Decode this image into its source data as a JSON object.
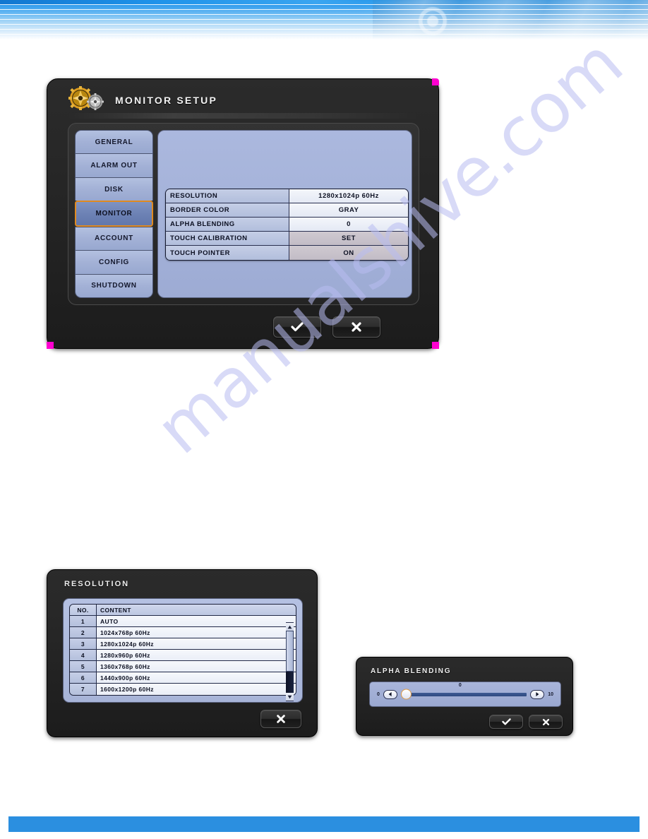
{
  "page": {
    "watermark": "manualshive.com",
    "accent_blue": "#2b8fe0",
    "panel_blue": "#a8b5d9",
    "highlight_orange": "#e08a20"
  },
  "monitor_setup": {
    "title": "MONITOR SETUP",
    "icon": "gears-icon",
    "sidebar": [
      {
        "label": "GENERAL",
        "selected": false
      },
      {
        "label": "ALARM OUT",
        "selected": false
      },
      {
        "label": "DISK",
        "selected": false
      },
      {
        "label": "MONITOR",
        "selected": true
      },
      {
        "label": "ACCOUNT",
        "selected": false
      },
      {
        "label": "CONFIG",
        "selected": false
      },
      {
        "label": "SHUTDOWN",
        "selected": false
      }
    ],
    "settings": [
      {
        "key": "RESOLUTION",
        "value": "1280x1024p 60Hz",
        "dim": false
      },
      {
        "key": "BORDER COLOR",
        "value": "GRAY",
        "dim": false
      },
      {
        "key": "ALPHA BLENDING",
        "value": "0",
        "dim": false
      },
      {
        "key": "TOUCH CALIBRATION",
        "value": "SET",
        "dim": true
      },
      {
        "key": "TOUCH POINTER",
        "value": "ON",
        "dim": true
      }
    ],
    "buttons": {
      "confirm": "check-icon",
      "cancel": "close-icon"
    }
  },
  "resolution_dialog": {
    "title": "RESOLUTION",
    "columns": [
      "NO.",
      "CONTENT"
    ],
    "rows": [
      {
        "no": "1",
        "content": "AUTO"
      },
      {
        "no": "2",
        "content": "1024x768p 60Hz"
      },
      {
        "no": "3",
        "content": "1280x1024p 60Hz"
      },
      {
        "no": "4",
        "content": "1280x960p 60Hz"
      },
      {
        "no": "5",
        "content": "1360x768p 60Hz"
      },
      {
        "no": "6",
        "content": "1440x900p 60Hz"
      },
      {
        "no": "7",
        "content": "1600x1200p 60Hz"
      }
    ],
    "scrollbar": {
      "up": "scroll-up-icon",
      "down": "scroll-down-icon"
    },
    "buttons": {
      "cancel": "close-icon"
    }
  },
  "alpha_dialog": {
    "title": "ALPHA BLENDING",
    "min": "0",
    "max": "10",
    "value": "0",
    "left_arrow": "left-arrow-icon",
    "right_arrow": "right-arrow-icon",
    "buttons": {
      "confirm": "check-icon",
      "cancel": "close-icon"
    }
  }
}
